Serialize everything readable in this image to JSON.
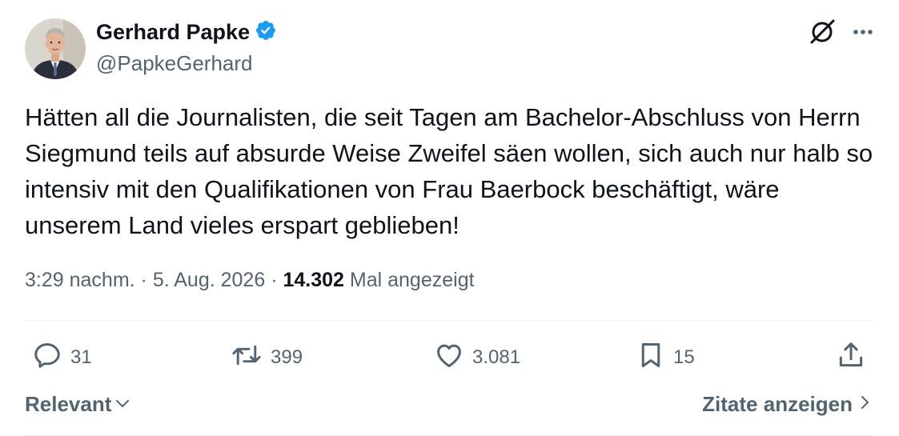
{
  "author": {
    "display_name": "Gerhard Papke",
    "handle": "@PapkeGerhard",
    "verified": true,
    "verified_color": "#1d9bf0"
  },
  "tweet": {
    "text": "Hätten all die Journalisten, die seit Tagen am Bachelor-Abschluss von Herrn Siegmund teils auf absurde Weise Zweifel säen wollen, sich auch nur halb so intensiv mit den Qualifikationen von Frau Baerbock beschäftigt, wäre unserem Land vieles erspart geblieben!",
    "time": "3:29 nachm.",
    "separator": "·",
    "date": "5. Aug. 2026",
    "views_count": "14.302",
    "views_label": "Mal angezeigt"
  },
  "actions": {
    "replies": "31",
    "reposts": "399",
    "likes": "3.081",
    "bookmarks": "15"
  },
  "footer": {
    "sort_label": "Relevant",
    "quotes_label": "Zitate anzeigen"
  },
  "icons": [
    "grok-icon",
    "more-icon",
    "reply-icon",
    "repost-icon",
    "like-icon",
    "bookmark-icon",
    "share-icon",
    "chevron-down-icon",
    "chevron-right-icon",
    "verified-badge-icon"
  ],
  "colors": {
    "text": "#0f1419",
    "secondary": "#536471",
    "divider": "#eff3f4",
    "accent": "#1d9bf0"
  }
}
